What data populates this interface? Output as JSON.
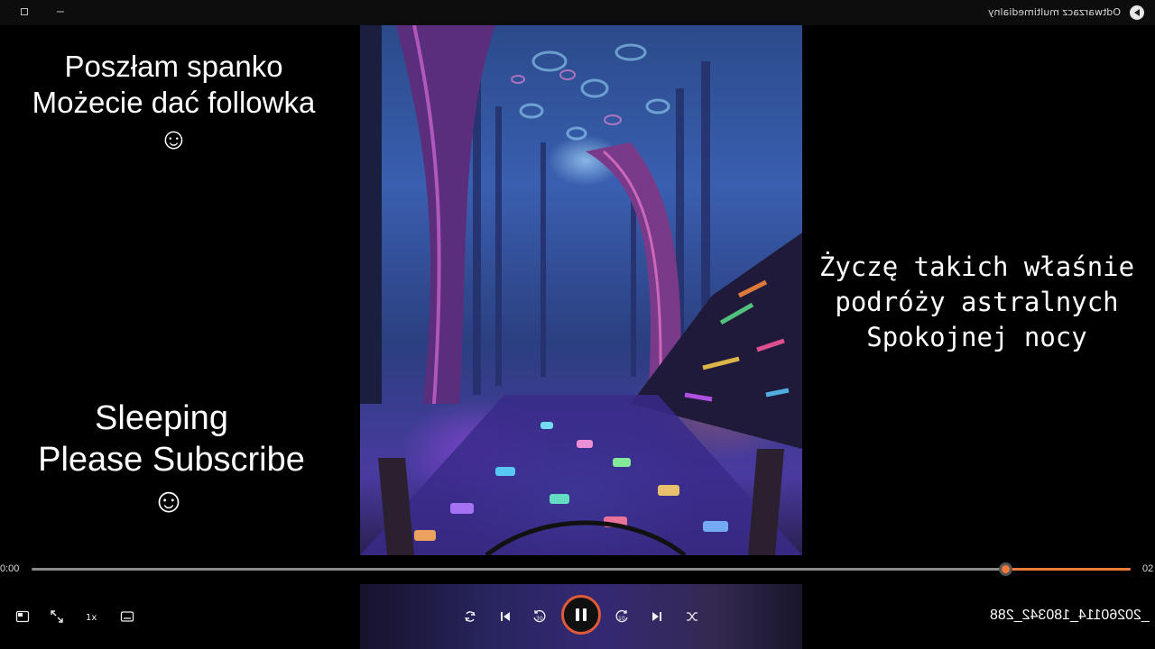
{
  "window": {
    "title": "Odtwarzacz multimedialny"
  },
  "overlay": {
    "left_top": [
      "Poszłam spanko",
      "Możecie dać followka",
      "☺"
    ],
    "left_bottom": [
      "Sleeping",
      "Please Subscribe",
      "☺"
    ],
    "right_middle": [
      "Życzę takich właśnie",
      "podróży astralnych",
      "Spokojnej nocy"
    ]
  },
  "player": {
    "time_elapsed": "0:00",
    "time_remaining": "02",
    "progress": 0.886,
    "file_name": "_20260114_180342_288",
    "accent_color": "#f07a3a"
  },
  "controls": {
    "left": [
      {
        "icon": "mini-player-icon"
      },
      {
        "icon": "fullscreen-icon"
      },
      {
        "icon": "playback-speed-icon",
        "label": "1x"
      },
      {
        "icon": "subtitles-icon"
      }
    ],
    "center": [
      {
        "icon": "repeat-icon"
      },
      {
        "icon": "previous-icon"
      },
      {
        "icon": "rewind-icon",
        "label": "30"
      },
      {
        "icon": "pause-icon"
      },
      {
        "icon": "forward-icon",
        "label": "10"
      },
      {
        "icon": "next-icon"
      },
      {
        "icon": "shuffle-icon"
      }
    ]
  }
}
